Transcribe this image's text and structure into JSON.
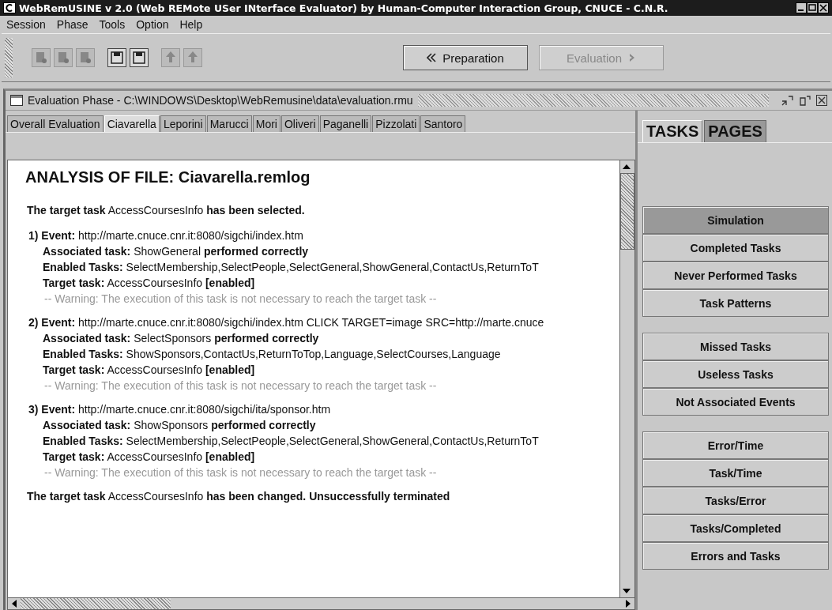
{
  "window": {
    "title": "WebRemUSINE v 2.0 (Web REMote USer INterface Evaluator) by Human-Computer Interaction Group, CNUCE - C.N.R."
  },
  "menu": [
    "Session",
    "Phase",
    "Tools",
    "Option",
    "Help"
  ],
  "toolbar": {
    "phase_buttons": [
      {
        "label": "Preparation",
        "kind": "back",
        "disabled": false
      },
      {
        "label": "Evaluation",
        "kind": "forward",
        "disabled": true
      }
    ]
  },
  "frame": {
    "title": "Evaluation Phase - C:\\WINDOWS\\Desktop\\WebRemusine\\data\\evaluation.rmu"
  },
  "tabs": [
    {
      "label": "Overall Evaluation",
      "selected": false
    },
    {
      "label": "Ciavarella",
      "selected": true
    },
    {
      "label": "Leporini",
      "selected": false
    },
    {
      "label": "Marucci",
      "selected": false
    },
    {
      "label": "Mori",
      "selected": false
    },
    {
      "label": "Oliveri",
      "selected": false
    },
    {
      "label": "Paganelli",
      "selected": false
    },
    {
      "label": "Pizzolati",
      "selected": false
    },
    {
      "label": "Santoro",
      "selected": false
    }
  ],
  "report": {
    "heading": "ANALYSIS OF FILE: Ciavarella.remlog",
    "lines": [
      {
        "kind": "summary",
        "text": "**The target task** AccessCoursesInfo **has been selected.**"
      },
      {
        "kind": "event",
        "text": "**1) Event:** http://marte.cnuce.cnr.it:8080/sigchi/index.htm"
      },
      {
        "kind": "detail",
        "text": "**Associated task:** ShowGeneral **performed correctly**"
      },
      {
        "kind": "detail",
        "text": "**Enabled Tasks:** SelectMembership,SelectPeople,SelectGeneral,ShowGeneral,ContactUs,ReturnToT"
      },
      {
        "kind": "detail",
        "text": "**Target task:** AccessCoursesInfo **[enabled]**"
      },
      {
        "kind": "warning",
        "text": "-- Warning: The execution of this task is not necessary to reach the target task --"
      },
      {
        "kind": "event",
        "text": "**2) Event:** http://marte.cnuce.cnr.it:8080/sigchi/index.htm CLICK TARGET=image SRC=http://marte.cnuce"
      },
      {
        "kind": "detail",
        "text": "**Associated task:** SelectSponsors **performed correctly**"
      },
      {
        "kind": "detail",
        "text": "**Enabled Tasks:** ShowSponsors,ContactUs,ReturnToTop,Language,SelectCourses,Language"
      },
      {
        "kind": "detail",
        "text": "**Target task:** AccessCoursesInfo **[enabled]**"
      },
      {
        "kind": "warning",
        "text": "-- Warning: The execution of this task is not necessary to reach the target task --"
      },
      {
        "kind": "event",
        "text": "**3) Event:** http://marte.cnuce.cnr.it:8080/sigchi/ita/sponsor.htm"
      },
      {
        "kind": "detail",
        "text": "**Associated task:** ShowSponsors **performed correctly**"
      },
      {
        "kind": "detail",
        "text": "**Enabled Tasks:** SelectMembership,SelectPeople,SelectGeneral,ShowGeneral,ContactUs,ReturnToT"
      },
      {
        "kind": "detail",
        "text": "**Target task:** AccessCoursesInfo **[enabled]**"
      },
      {
        "kind": "warning",
        "text": "-- Warning: The execution of this task is not necessary to reach the target task --"
      },
      {
        "kind": "summary",
        "text": "**The target task** AccessCoursesInfo **has been changed. Unsuccessfully terminated**"
      }
    ]
  },
  "side_tabs": [
    {
      "label": "TASKS",
      "selected": true
    },
    {
      "label": "PAGES",
      "selected": false
    }
  ],
  "side_groups": [
    [
      {
        "label": "Simulation",
        "selected": true
      },
      {
        "label": "Completed Tasks",
        "selected": false
      },
      {
        "label": "Never Performed Tasks",
        "selected": false
      },
      {
        "label": "Task Patterns",
        "selected": false
      }
    ],
    [
      {
        "label": "Missed Tasks",
        "selected": false
      },
      {
        "label": "Useless Tasks",
        "selected": false
      },
      {
        "label": "Not Associated Events",
        "selected": false
      }
    ],
    [
      {
        "label": "Error/Time",
        "selected": false
      },
      {
        "label": "Task/Time",
        "selected": false
      },
      {
        "label": "Tasks/Error",
        "selected": false
      },
      {
        "label": "Tasks/Completed",
        "selected": false
      },
      {
        "label": "Errors and Tasks",
        "selected": false
      }
    ]
  ]
}
